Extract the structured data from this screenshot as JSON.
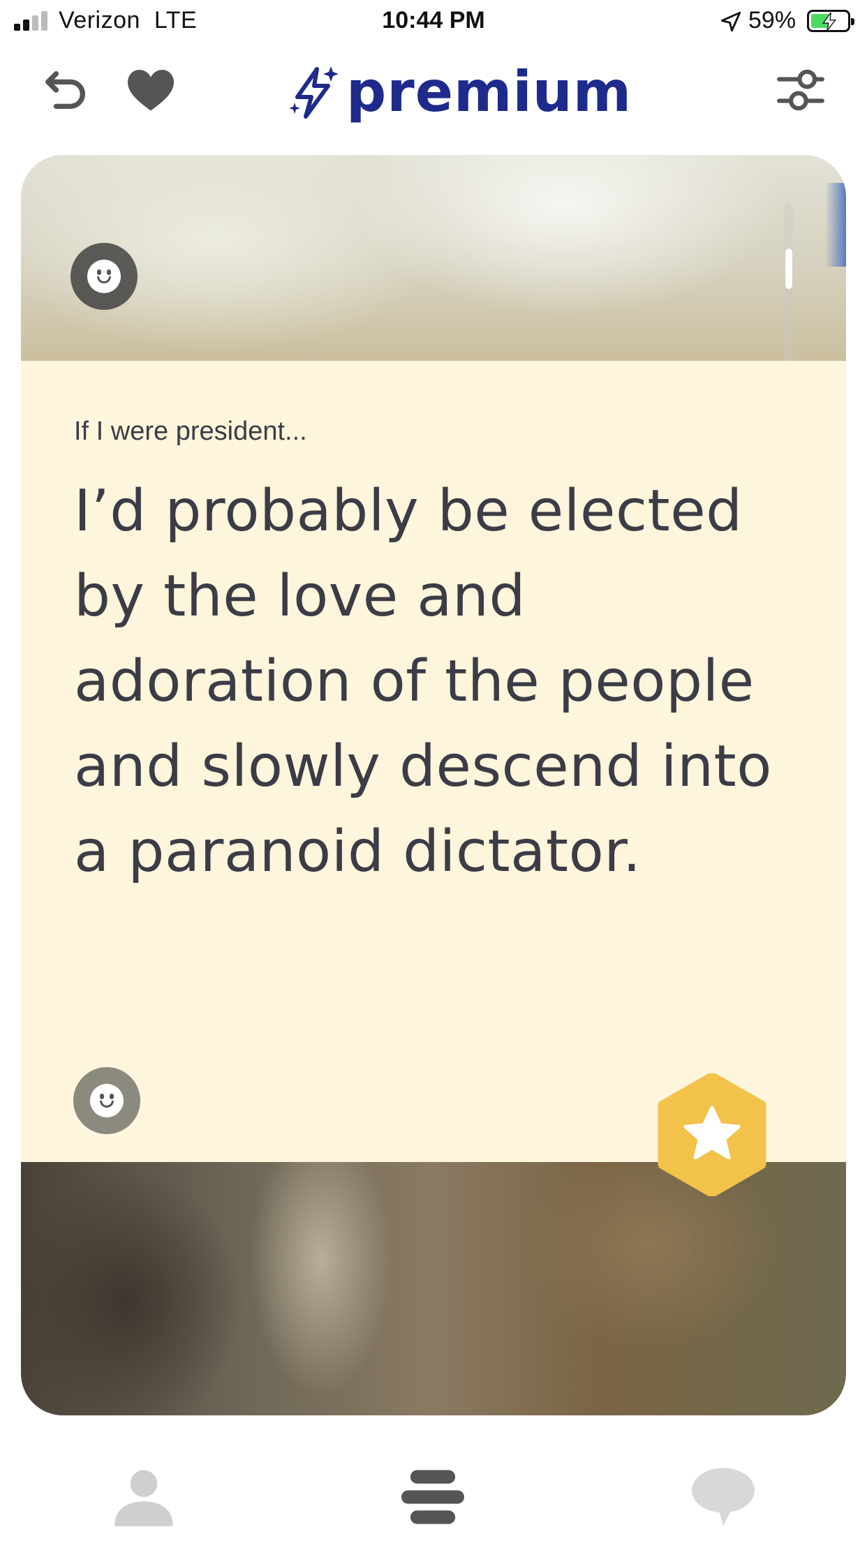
{
  "status_bar": {
    "carrier": "Verizon",
    "network": "LTE",
    "time": "10:44 PM",
    "battery_percent": "59%",
    "battery_level": 0.59,
    "charging": true,
    "location_icon": "location-arrow-icon",
    "signal_bars": 2
  },
  "top_bar": {
    "brand_label": "premium",
    "brand_color": "#1e2a8c",
    "icons": [
      "undo-icon",
      "heart-icon",
      "sparkle-bolt-icon",
      "filters-icon"
    ]
  },
  "card": {
    "prompt_question": "If I were president...",
    "prompt_answer": "I’d probably be elected by the love and adoration of the people and slowly descend into a paranoid dictator.",
    "background_color": "#fdf5dc",
    "star_color": "#f2c24a"
  },
  "tab_bar": {
    "tabs": [
      "profile-tab",
      "discover-tab",
      "messages-tab"
    ],
    "active": "discover-tab"
  }
}
